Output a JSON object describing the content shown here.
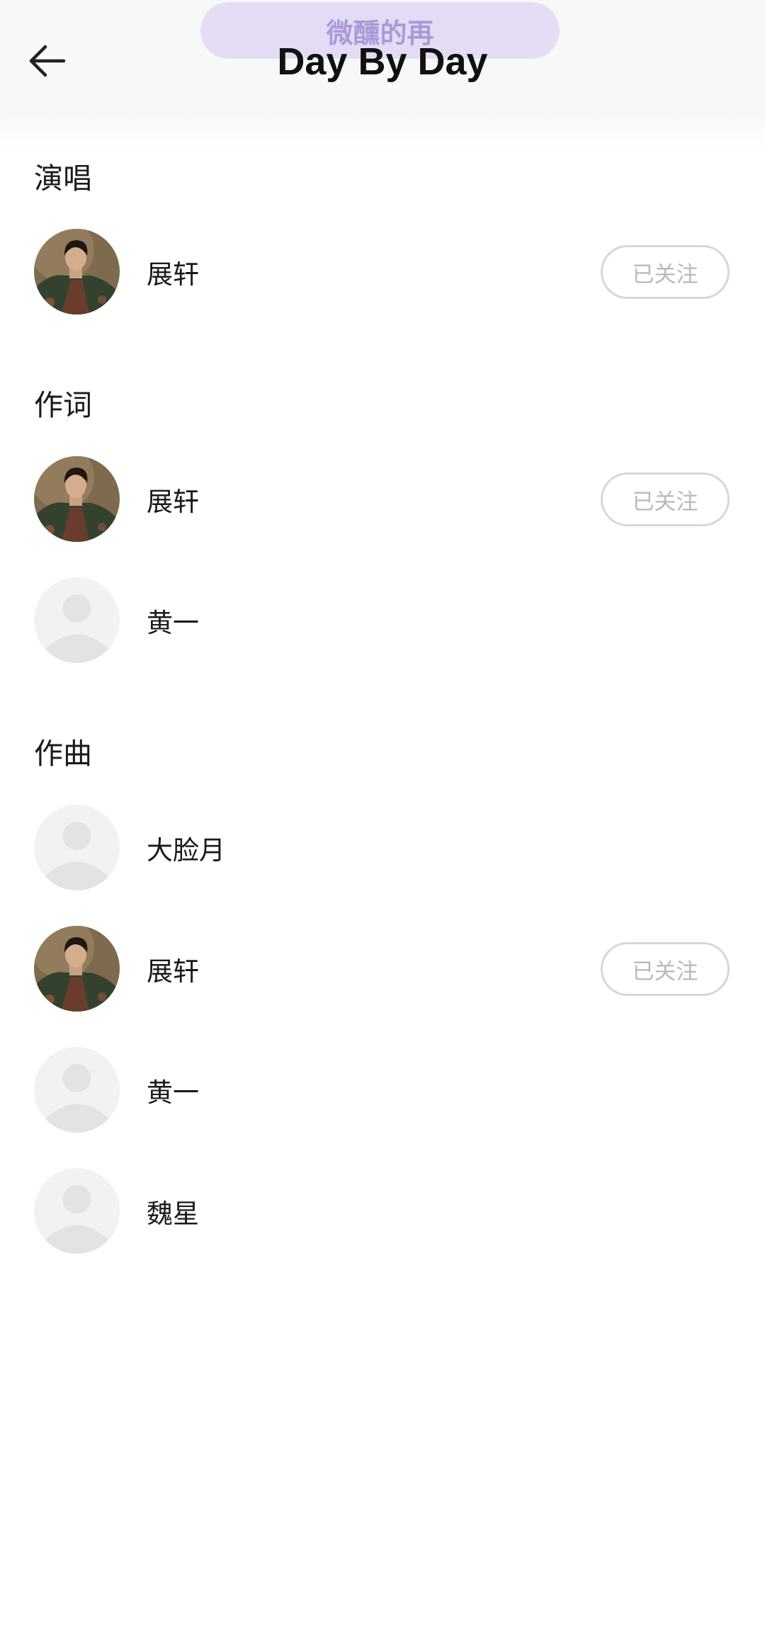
{
  "overlay_text": "微醺的再",
  "header": {
    "title": "Day By Day"
  },
  "sections": [
    {
      "label": "演唱",
      "artists": [
        {
          "name": "展轩",
          "avatar": "photo",
          "follow": "已关注"
        }
      ]
    },
    {
      "label": "作词",
      "artists": [
        {
          "name": "展轩",
          "avatar": "photo",
          "follow": "已关注"
        },
        {
          "name": "黄一",
          "avatar": "placeholder"
        }
      ]
    },
    {
      "label": "作曲",
      "artists": [
        {
          "name": "大脸月",
          "avatar": "placeholder"
        },
        {
          "name": "展轩",
          "avatar": "photo",
          "follow": "已关注"
        },
        {
          "name": "黄一",
          "avatar": "placeholder"
        },
        {
          "name": "魏星",
          "avatar": "placeholder"
        }
      ]
    }
  ]
}
